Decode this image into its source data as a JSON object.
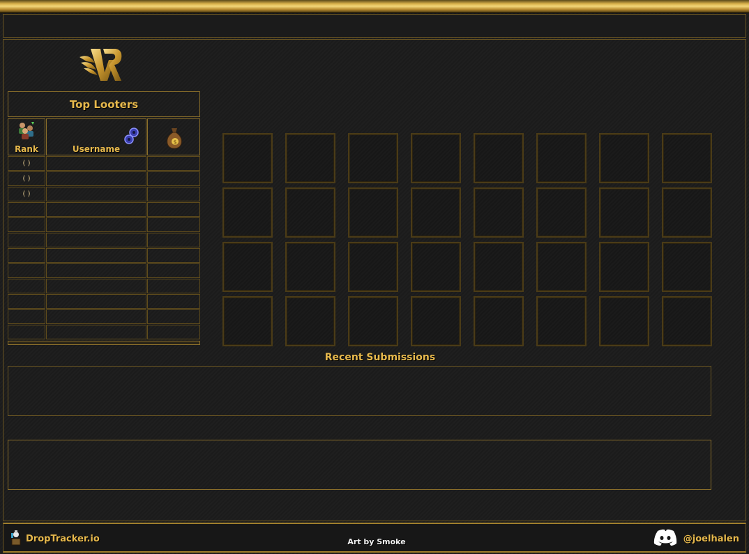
{
  "leaderboard": {
    "title": "Top Looters",
    "columns": {
      "rank": "Rank",
      "username": "Username",
      "value": ""
    },
    "rows": [
      {
        "rank": "( )",
        "username": "",
        "value": ""
      },
      {
        "rank": "( )",
        "username": "",
        "value": ""
      },
      {
        "rank": "( )",
        "username": "",
        "value": ""
      },
      {
        "rank": "",
        "username": "",
        "value": ""
      },
      {
        "rank": "",
        "username": "",
        "value": ""
      },
      {
        "rank": "",
        "username": "",
        "value": ""
      },
      {
        "rank": "",
        "username": "",
        "value": ""
      },
      {
        "rank": "",
        "username": "",
        "value": ""
      },
      {
        "rank": "",
        "username": "",
        "value": ""
      },
      {
        "rank": "",
        "username": "",
        "value": ""
      },
      {
        "rank": "",
        "username": "",
        "value": ""
      },
      {
        "rank": "",
        "username": "",
        "value": ""
      }
    ],
    "icons": {
      "rank": "players-icon",
      "username": "cog-icon",
      "value": "money-bag-icon"
    }
  },
  "loot_grid": {
    "rows": 4,
    "columns": 8
  },
  "recent": {
    "title": "Recent Submissions"
  },
  "footer": {
    "site": "DropTracker.io",
    "credit": "Art by Smoke",
    "discord_handle": "@joelhalen",
    "icons": {
      "site": "droptracker-icon",
      "discord": "discord-icon"
    }
  },
  "colors": {
    "accent_gold": "#e6b84c",
    "border_gold": "#8a6e2a",
    "background": "#1b1b1b"
  },
  "logo": {
    "icon": "winged-v-logo"
  }
}
